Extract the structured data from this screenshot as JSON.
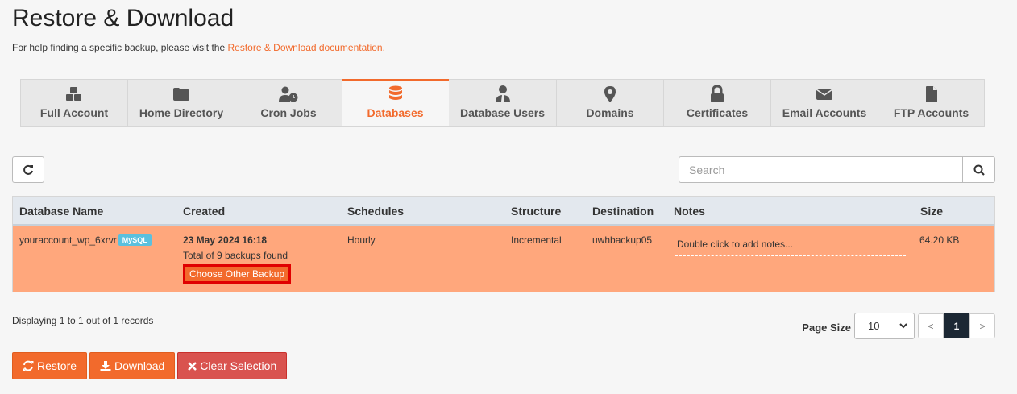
{
  "page": {
    "title": "Restore & Download",
    "help_prefix": "For help finding a specific backup, please visit the ",
    "help_link": "Restore & Download documentation."
  },
  "tabs": [
    {
      "label": "Full Account",
      "icon": "cubes-icon"
    },
    {
      "label": "Home Directory",
      "icon": "folder-icon"
    },
    {
      "label": "Cron Jobs",
      "icon": "user-clock-icon"
    },
    {
      "label": "Databases",
      "icon": "database-icon",
      "active": true
    },
    {
      "label": "Database Users",
      "icon": "user-tie-icon"
    },
    {
      "label": "Domains",
      "icon": "map-marker-icon"
    },
    {
      "label": "Certificates",
      "icon": "lock-icon"
    },
    {
      "label": "Email Accounts",
      "icon": "envelope-icon"
    },
    {
      "label": "FTP Accounts",
      "icon": "file-icon"
    }
  ],
  "search": {
    "placeholder": "Search"
  },
  "table": {
    "headers": {
      "name": "Database Name",
      "created": "Created",
      "schedules": "Schedules",
      "structure": "Structure",
      "destination": "Destination",
      "notes": "Notes",
      "size": "Size"
    },
    "row": {
      "name": "youraccount_wp_6xrvr",
      "badge": "MySQL",
      "created_date": "23 May 2024 16:18",
      "created_total": "Total of 9 backups found",
      "choose_label": "Choose Other Backup",
      "schedule": "Hourly",
      "structure": "Incremental",
      "destination": "uwhbackup05",
      "notes": "Double click to add notes...",
      "size": "64.20 KB"
    }
  },
  "records": "Displaying 1 to 1 out of 1 records",
  "pager": {
    "label": "Page Size",
    "size": "10",
    "prev": "<",
    "current": "1",
    "next": ">"
  },
  "actions": {
    "restore": "Restore",
    "download": "Download",
    "clear": "Clear Selection"
  },
  "colors": {
    "accent": "#f26a2c",
    "row_selected": "#ffa77c",
    "danger": "#d9534f",
    "badge": "#5bc0de"
  }
}
